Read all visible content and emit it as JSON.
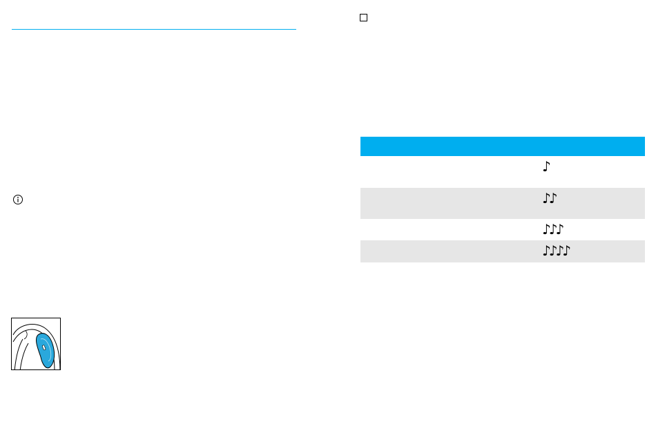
{
  "colors": {
    "accent": "#00aeef",
    "row_shade": "#e6e6e6",
    "figure_highlight": "#2aa8dc"
  },
  "icons": {
    "info": "info-circle-icon",
    "checkbox": "empty-checkbox-icon",
    "figure": "headset-button-illustration"
  },
  "table": {
    "rows": [
      {
        "notes": "♪",
        "shaded": false
      },
      {
        "notes": "♪♪",
        "shaded": true
      },
      {
        "notes": "♪♪♪",
        "shaded": false
      },
      {
        "notes": "♪♪♪♪",
        "shaded": true
      }
    ]
  }
}
